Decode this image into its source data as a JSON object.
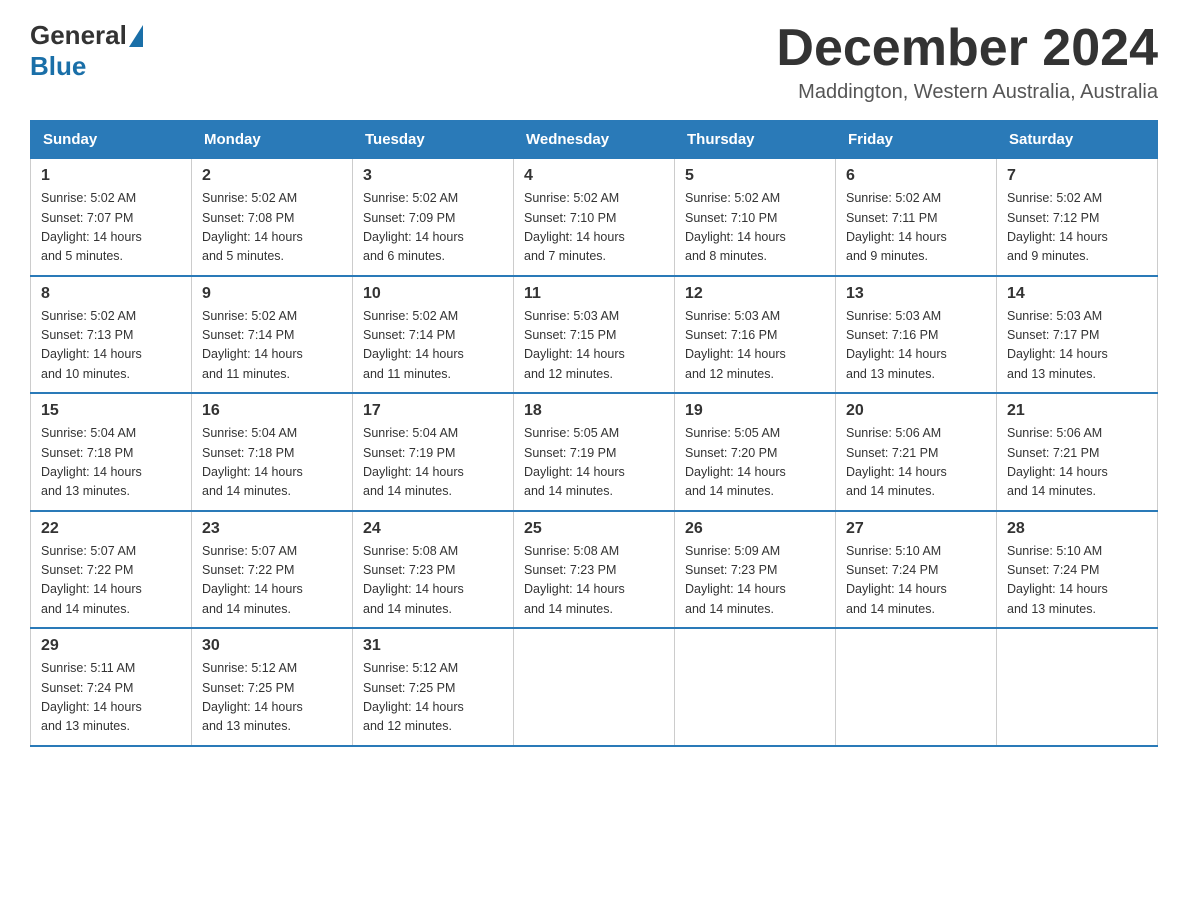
{
  "logo": {
    "general": "General",
    "blue": "Blue",
    "subtitle": "Blue"
  },
  "header": {
    "title": "December 2024",
    "location": "Maddington, Western Australia, Australia"
  },
  "weekdays": [
    "Sunday",
    "Monday",
    "Tuesday",
    "Wednesday",
    "Thursday",
    "Friday",
    "Saturday"
  ],
  "weeks": [
    [
      {
        "day": "1",
        "sunrise": "5:02 AM",
        "sunset": "7:07 PM",
        "daylight": "14 hours and 5 minutes."
      },
      {
        "day": "2",
        "sunrise": "5:02 AM",
        "sunset": "7:08 PM",
        "daylight": "14 hours and 5 minutes."
      },
      {
        "day": "3",
        "sunrise": "5:02 AM",
        "sunset": "7:09 PM",
        "daylight": "14 hours and 6 minutes."
      },
      {
        "day": "4",
        "sunrise": "5:02 AM",
        "sunset": "7:10 PM",
        "daylight": "14 hours and 7 minutes."
      },
      {
        "day": "5",
        "sunrise": "5:02 AM",
        "sunset": "7:10 PM",
        "daylight": "14 hours and 8 minutes."
      },
      {
        "day": "6",
        "sunrise": "5:02 AM",
        "sunset": "7:11 PM",
        "daylight": "14 hours and 9 minutes."
      },
      {
        "day": "7",
        "sunrise": "5:02 AM",
        "sunset": "7:12 PM",
        "daylight": "14 hours and 9 minutes."
      }
    ],
    [
      {
        "day": "8",
        "sunrise": "5:02 AM",
        "sunset": "7:13 PM",
        "daylight": "14 hours and 10 minutes."
      },
      {
        "day": "9",
        "sunrise": "5:02 AM",
        "sunset": "7:14 PM",
        "daylight": "14 hours and 11 minutes."
      },
      {
        "day": "10",
        "sunrise": "5:02 AM",
        "sunset": "7:14 PM",
        "daylight": "14 hours and 11 minutes."
      },
      {
        "day": "11",
        "sunrise": "5:03 AM",
        "sunset": "7:15 PM",
        "daylight": "14 hours and 12 minutes."
      },
      {
        "day": "12",
        "sunrise": "5:03 AM",
        "sunset": "7:16 PM",
        "daylight": "14 hours and 12 minutes."
      },
      {
        "day": "13",
        "sunrise": "5:03 AM",
        "sunset": "7:16 PM",
        "daylight": "14 hours and 13 minutes."
      },
      {
        "day": "14",
        "sunrise": "5:03 AM",
        "sunset": "7:17 PM",
        "daylight": "14 hours and 13 minutes."
      }
    ],
    [
      {
        "day": "15",
        "sunrise": "5:04 AM",
        "sunset": "7:18 PM",
        "daylight": "14 hours and 13 minutes."
      },
      {
        "day": "16",
        "sunrise": "5:04 AM",
        "sunset": "7:18 PM",
        "daylight": "14 hours and 14 minutes."
      },
      {
        "day": "17",
        "sunrise": "5:04 AM",
        "sunset": "7:19 PM",
        "daylight": "14 hours and 14 minutes."
      },
      {
        "day": "18",
        "sunrise": "5:05 AM",
        "sunset": "7:19 PM",
        "daylight": "14 hours and 14 minutes."
      },
      {
        "day": "19",
        "sunrise": "5:05 AM",
        "sunset": "7:20 PM",
        "daylight": "14 hours and 14 minutes."
      },
      {
        "day": "20",
        "sunrise": "5:06 AM",
        "sunset": "7:21 PM",
        "daylight": "14 hours and 14 minutes."
      },
      {
        "day": "21",
        "sunrise": "5:06 AM",
        "sunset": "7:21 PM",
        "daylight": "14 hours and 14 minutes."
      }
    ],
    [
      {
        "day": "22",
        "sunrise": "5:07 AM",
        "sunset": "7:22 PM",
        "daylight": "14 hours and 14 minutes."
      },
      {
        "day": "23",
        "sunrise": "5:07 AM",
        "sunset": "7:22 PM",
        "daylight": "14 hours and 14 minutes."
      },
      {
        "day": "24",
        "sunrise": "5:08 AM",
        "sunset": "7:23 PM",
        "daylight": "14 hours and 14 minutes."
      },
      {
        "day": "25",
        "sunrise": "5:08 AM",
        "sunset": "7:23 PM",
        "daylight": "14 hours and 14 minutes."
      },
      {
        "day": "26",
        "sunrise": "5:09 AM",
        "sunset": "7:23 PM",
        "daylight": "14 hours and 14 minutes."
      },
      {
        "day": "27",
        "sunrise": "5:10 AM",
        "sunset": "7:24 PM",
        "daylight": "14 hours and 14 minutes."
      },
      {
        "day": "28",
        "sunrise": "5:10 AM",
        "sunset": "7:24 PM",
        "daylight": "14 hours and 13 minutes."
      }
    ],
    [
      {
        "day": "29",
        "sunrise": "5:11 AM",
        "sunset": "7:24 PM",
        "daylight": "14 hours and 13 minutes."
      },
      {
        "day": "30",
        "sunrise": "5:12 AM",
        "sunset": "7:25 PM",
        "daylight": "14 hours and 13 minutes."
      },
      {
        "day": "31",
        "sunrise": "5:12 AM",
        "sunset": "7:25 PM",
        "daylight": "14 hours and 12 minutes."
      },
      null,
      null,
      null,
      null
    ]
  ]
}
